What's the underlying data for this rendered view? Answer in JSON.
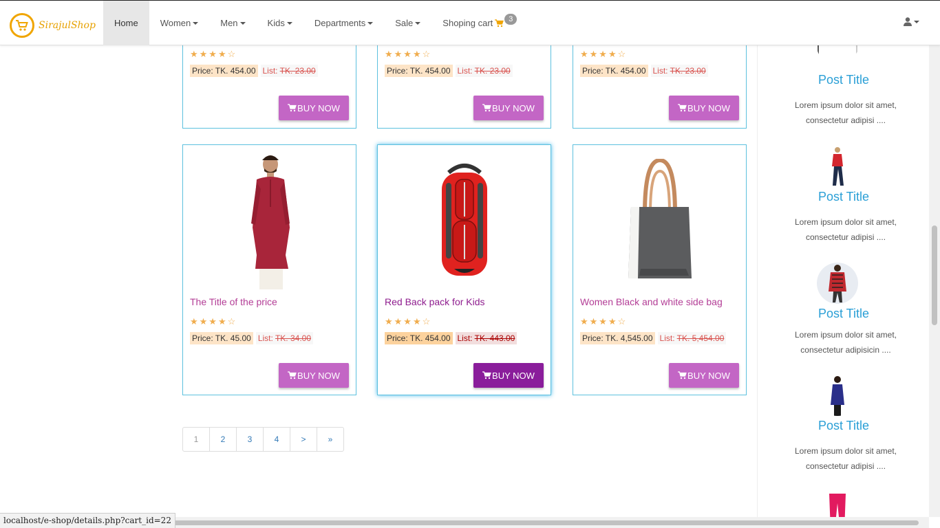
{
  "brand": {
    "name": "SirajulShop"
  },
  "nav": {
    "items": [
      {
        "label": "Home",
        "active": true,
        "dropdown": false
      },
      {
        "label": "Women",
        "dropdown": true
      },
      {
        "label": "Men",
        "dropdown": true
      },
      {
        "label": "Kids",
        "dropdown": true
      },
      {
        "label": "Departments",
        "dropdown": true
      },
      {
        "label": "Sale",
        "dropdown": true
      }
    ],
    "cart": {
      "label": "Shoping cart",
      "count": "3",
      "icon": "shopping-cart-icon"
    },
    "user_icon": "user-icon"
  },
  "products_top": [
    {
      "rating": "★★★★☆",
      "price": "Price: TK. 454.00",
      "list_label": "List:",
      "list_price": "TK. 23.00",
      "button": "BUY NOW"
    },
    {
      "rating": "★★★★☆",
      "price": "Price: TK. 454.00",
      "list_label": "List:",
      "list_price": "TK. 23.00",
      "button": "BUY NOW"
    },
    {
      "rating": "★★★★☆",
      "price": "Price: TK. 454.00",
      "list_label": "List:",
      "list_price": "TK. 23.00",
      "button": "BUY NOW"
    }
  ],
  "products": [
    {
      "title": "The Title of the price",
      "rating": "★★★★☆",
      "price": "Price: TK. 45.00",
      "list_label": "List:",
      "list_price": "TK. 34.00",
      "button": "BUY NOW",
      "image": "man-kurta"
    },
    {
      "title": "Red Back pack for Kids",
      "rating": "★★★★☆",
      "price": "Price: TK. 454.00",
      "list_label": "List:",
      "list_price": "TK. 443.00",
      "button": "BUY NOW",
      "image": "red-backpack"
    },
    {
      "title": "Women Black and white side bag",
      "rating": "★★★★☆",
      "price": "Price: TK. 4,545.00",
      "list_label": "List:",
      "list_price": "TK. 5,454.00",
      "button": "BUY NOW",
      "image": "tote-bag"
    }
  ],
  "pagination": [
    "1",
    "2",
    "3",
    "4",
    ">",
    "»"
  ],
  "pagination_active": "1",
  "sidebar": {
    "posts": [
      {
        "title": "Post Title",
        "text": "Lorem ipsum dolor sit amet, consectetur adipisi ...."
      },
      {
        "title": "Post Title",
        "text": "Lorem ipsum dolor sit amet, consectetur adipisi ...."
      },
      {
        "title": "Post Title",
        "text": "Lorem ipsum dolor sit amet, consectetur adipisicin ...."
      },
      {
        "title": "Post Title",
        "text": "Lorem ipsum dolor sit amet, consectetur adipisi ...."
      }
    ]
  },
  "status_url": "localhost/e-shop/details.php?cart_id=22",
  "colors": {
    "accent": "#2a9fd6",
    "button": "#c366c5",
    "button_active": "#8a1d9b",
    "star": "#f0ad4e",
    "title": "#b33d96"
  }
}
